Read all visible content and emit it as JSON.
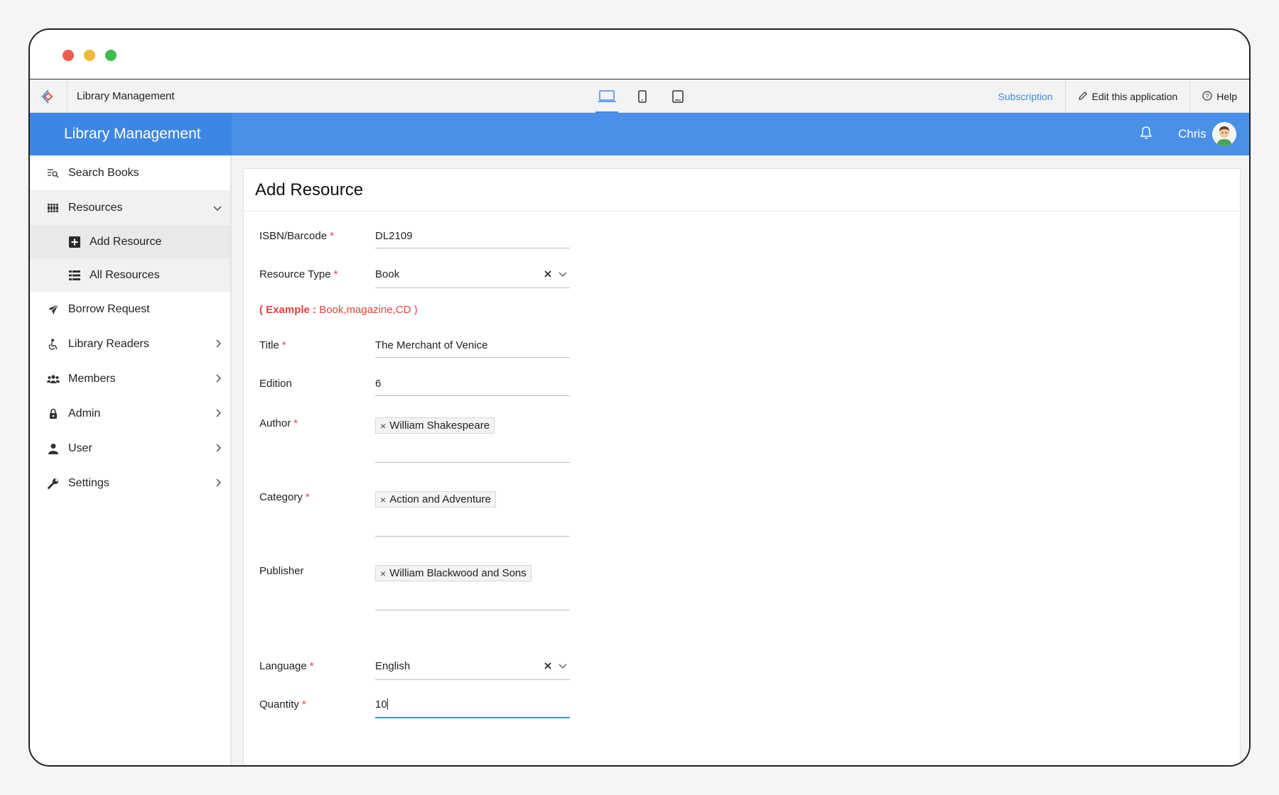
{
  "appbar": {
    "app_name": "Library Management",
    "subscription": "Subscription",
    "edit_app": "Edit this application",
    "help": "Help"
  },
  "topbar": {
    "brand": "Library Management",
    "user_name": "Chris"
  },
  "sidebar": {
    "items": [
      {
        "label": "Search Books",
        "icon": "search-list-icon"
      },
      {
        "label": "Resources",
        "icon": "books-icon",
        "expanded": true
      },
      {
        "label": "Borrow Request",
        "icon": "paper-plane-icon"
      },
      {
        "label": "Library Readers",
        "icon": "reader-icon"
      },
      {
        "label": "Members",
        "icon": "group-icon"
      },
      {
        "label": "Admin",
        "icon": "lock-icon"
      },
      {
        "label": "User",
        "icon": "user-icon"
      },
      {
        "label": "Settings",
        "icon": "wrench-icon"
      }
    ],
    "sub_items": [
      {
        "label": "Add Resource",
        "icon": "plus-square-icon",
        "active": true
      },
      {
        "label": "All Resources",
        "icon": "list-icon"
      }
    ]
  },
  "form": {
    "title": "Add Resource",
    "required_mark": "*",
    "isbn": {
      "label": "ISBN/Barcode",
      "value": "DL2109"
    },
    "resource_type": {
      "label": "Resource Type",
      "value": "Book"
    },
    "example": {
      "prefix": "( Example :",
      "text": " Book,magazine,CD )"
    },
    "title_field": {
      "label": "Title",
      "value": "The Merchant of Venice"
    },
    "edition": {
      "label": "Edition",
      "value": "6"
    },
    "author": {
      "label": "Author",
      "tag": "William Shakespeare"
    },
    "category": {
      "label": "Category",
      "tag": "Action and Adventure"
    },
    "publisher": {
      "label": "Publisher",
      "tag": "William Blackwood and Sons"
    },
    "language": {
      "label": "Language",
      "value": "English"
    },
    "quantity": {
      "label": "Quantity",
      "value": "10"
    }
  },
  "colors": {
    "accent": "#4a90e8",
    "required": "#e3423b"
  }
}
